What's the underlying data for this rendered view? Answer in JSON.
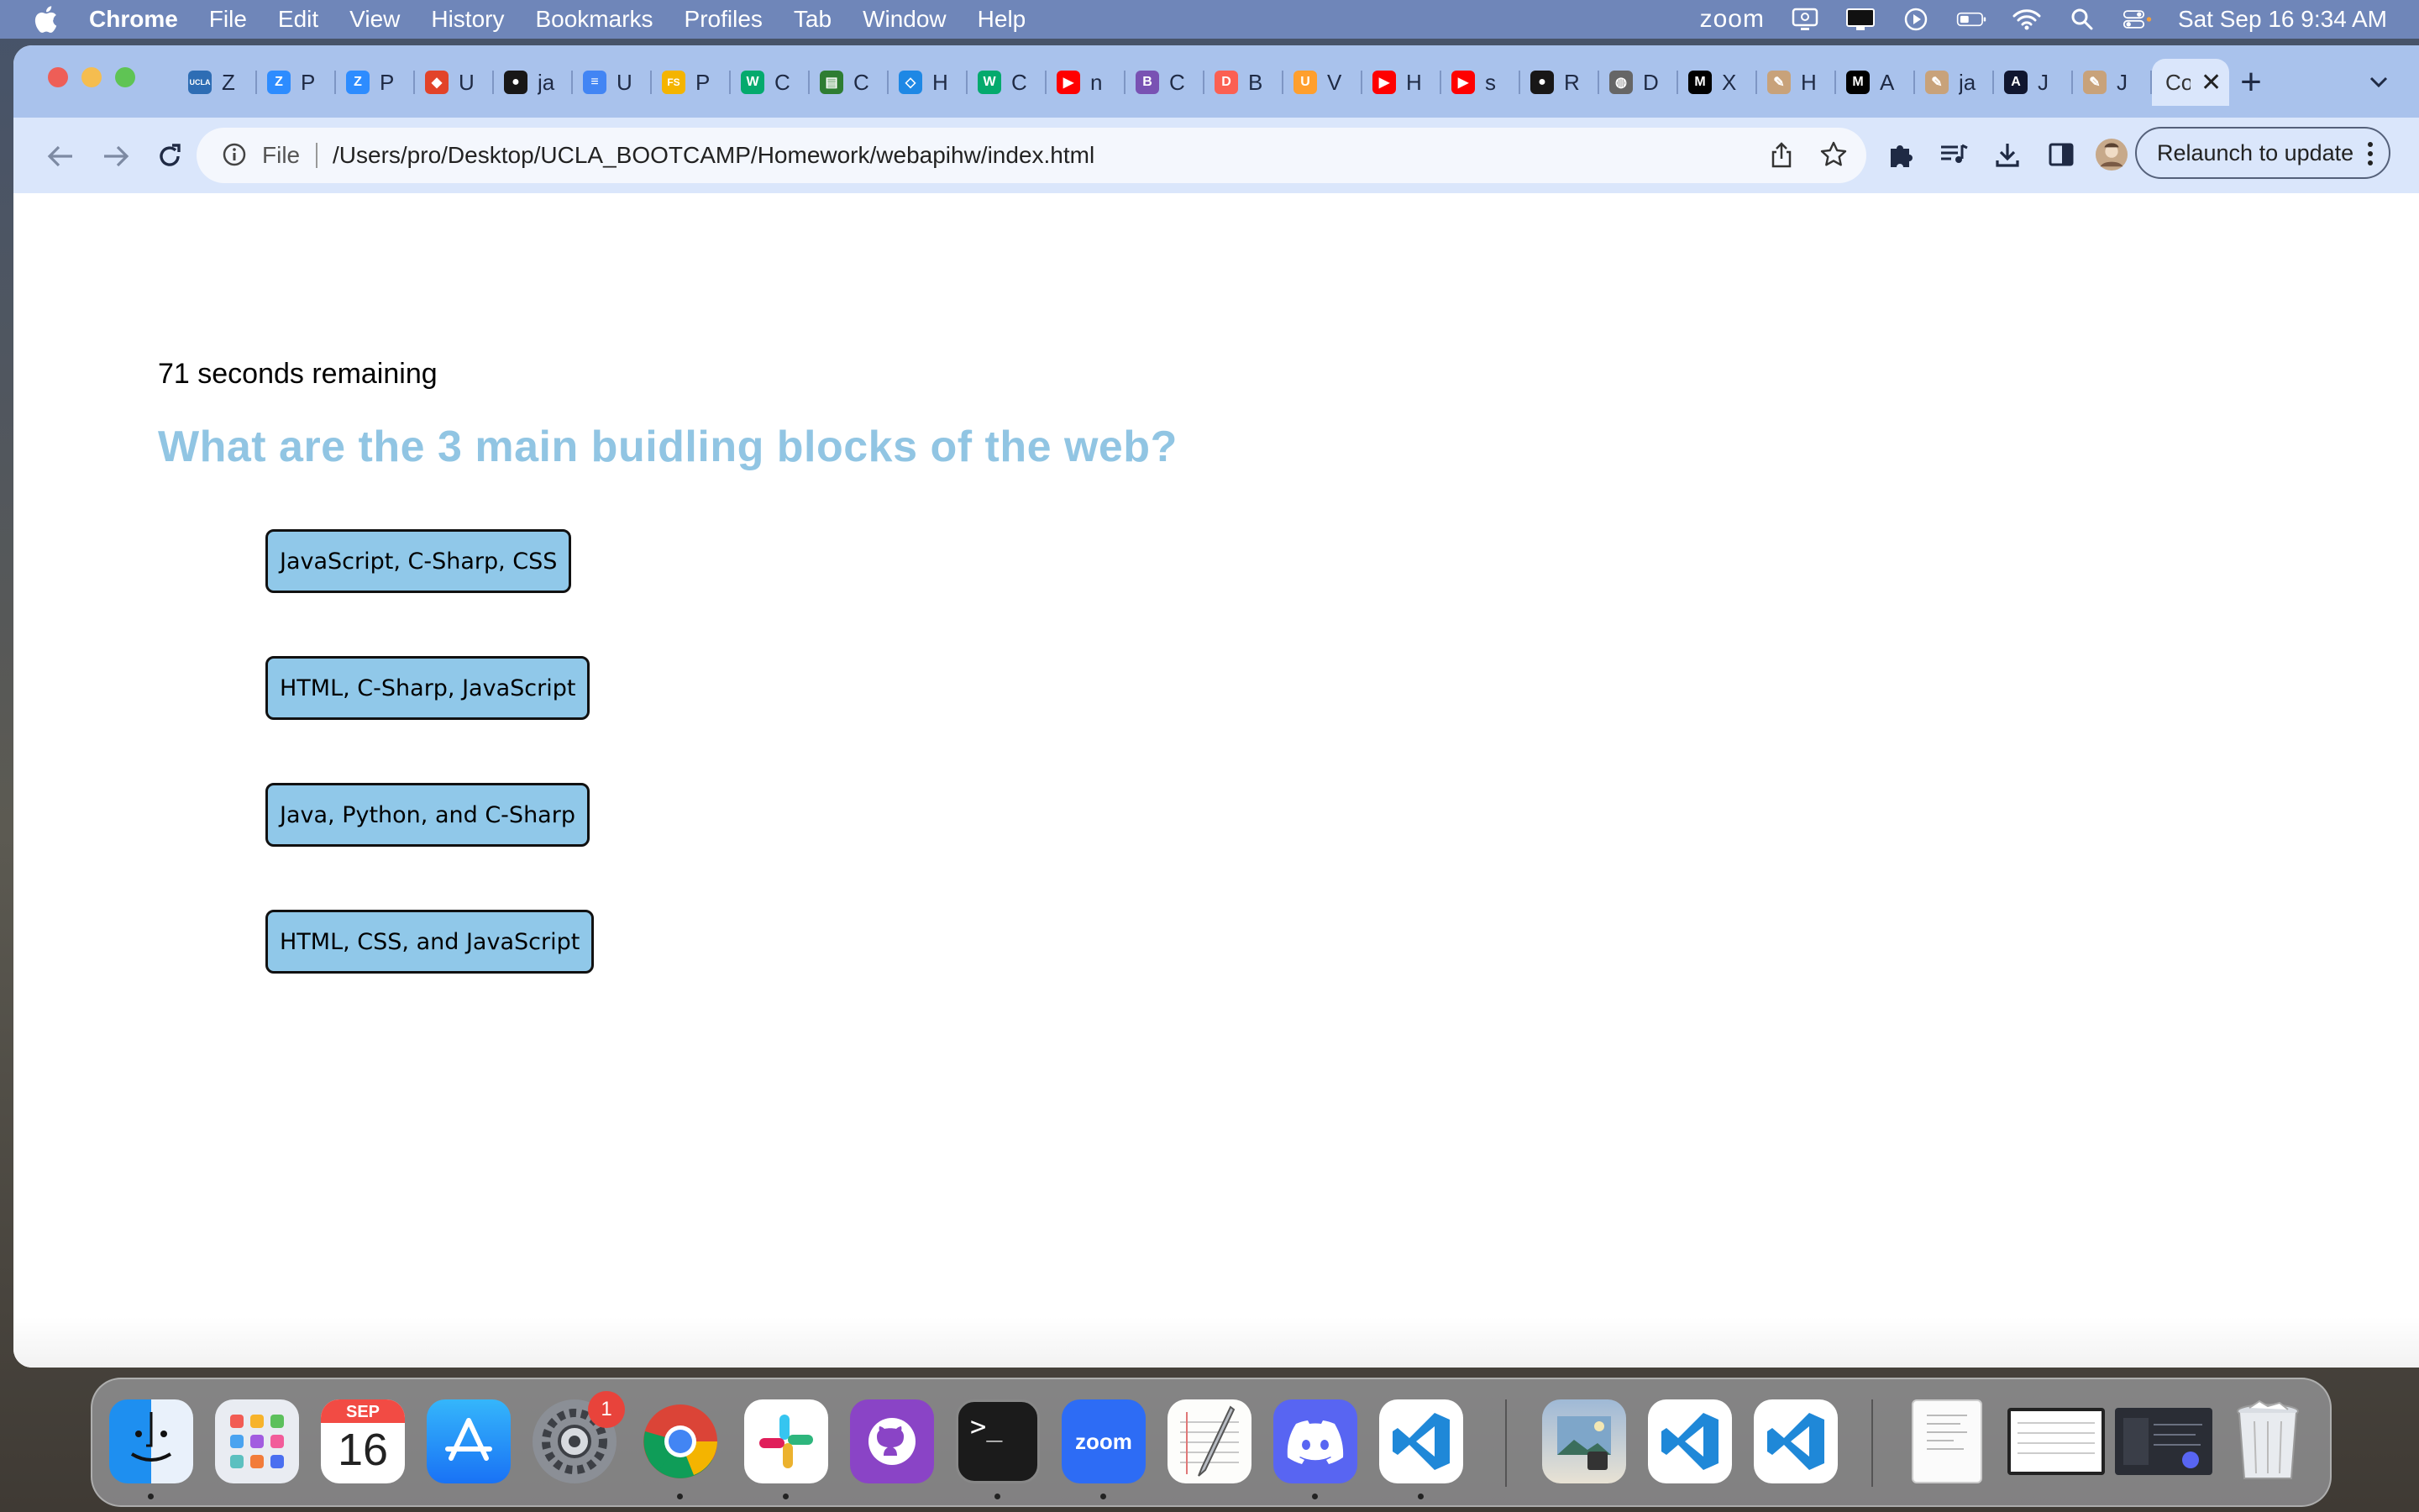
{
  "menubar": {
    "app_name": "Chrome",
    "menus": [
      "File",
      "Edit",
      "View",
      "History",
      "Bookmarks",
      "Profiles",
      "Tab",
      "Window",
      "Help"
    ],
    "zoom_label": "zoom",
    "datetime": "Sat Sep 16  9:34 AM"
  },
  "browser": {
    "tabs": [
      {
        "icon": "ucla-icon",
        "title": "Z",
        "color": "#2e6db4",
        "glyph": "UCLA"
      },
      {
        "icon": "zoom-icon",
        "title": "P",
        "color": "#2d8cff",
        "glyph": "Z"
      },
      {
        "icon": "zoom-icon",
        "title": "P",
        "color": "#2d8cff",
        "glyph": "Z"
      },
      {
        "icon": "gitlab-icon",
        "title": "U",
        "color": "#e24329",
        "glyph": "◆"
      },
      {
        "icon": "github-icon",
        "title": "ja",
        "color": "#181717",
        "glyph": "●"
      },
      {
        "icon": "docs-icon",
        "title": "U",
        "color": "#4285f4",
        "glyph": "≡"
      },
      {
        "icon": "fs-icon",
        "title": "P",
        "color": "#f4b400",
        "glyph": "FS"
      },
      {
        "icon": "w3schools-icon",
        "title": "C",
        "color": "#04aa6d",
        "glyph": "W"
      },
      {
        "icon": "library-icon",
        "title": "C",
        "color": "#2e7d32",
        "glyph": "▤"
      },
      {
        "icon": "code-icon",
        "title": "H",
        "color": "#1e88e5",
        "glyph": "◇"
      },
      {
        "icon": "w3schools-icon",
        "title": "C",
        "color": "#04aa6d",
        "glyph": "W"
      },
      {
        "icon": "youtube-icon",
        "title": "n",
        "color": "#ff0000",
        "glyph": "▶"
      },
      {
        "icon": "bootstrap-icon",
        "title": "C",
        "color": "#7952b3",
        "glyph": "B"
      },
      {
        "icon": "dayjs-icon",
        "title": "B",
        "color": "#fb6052",
        "glyph": "D"
      },
      {
        "icon": "ublock-icon",
        "title": "V",
        "color": "#ff9f2d",
        "glyph": "U"
      },
      {
        "icon": "youtube-icon",
        "title": "H",
        "color": "#ff0000",
        "glyph": "▶"
      },
      {
        "icon": "youtube-icon",
        "title": "s",
        "color": "#ff0000",
        "glyph": "▶"
      },
      {
        "icon": "github-icon",
        "title": "R",
        "color": "#181717",
        "glyph": "●"
      },
      {
        "icon": "globe-icon",
        "title": "D",
        "color": "#666666",
        "glyph": "◍"
      },
      {
        "icon": "mdn-icon",
        "title": "X",
        "color": "#000000",
        "glyph": "M"
      },
      {
        "icon": "postman-icon",
        "title": "H",
        "color": "#c8a27a",
        "glyph": "✎"
      },
      {
        "icon": "mdn-icon",
        "title": "A",
        "color": "#000000",
        "glyph": "M"
      },
      {
        "icon": "postman-icon",
        "title": "ja",
        "color": "#c8a27a",
        "glyph": "✎"
      },
      {
        "icon": "codecademy-icon",
        "title": "J",
        "color": "#10162f",
        "glyph": "A"
      },
      {
        "icon": "postman-icon",
        "title": "J",
        "color": "#c8a27a",
        "glyph": "✎"
      },
      {
        "icon": "file-icon",
        "title": "Co",
        "color": "#dae6fb",
        "glyph": "",
        "active": true
      }
    ],
    "url_scheme_label": "File",
    "url": "/Users/pro/Desktop/UCLA_BOOTCAMP/Homework/webapihw/index.html",
    "relaunch_label": "Relaunch to update"
  },
  "quiz": {
    "timer_text": "71 seconds remaining",
    "question": "What are the 3 main buidling blocks of the web?",
    "choices": [
      "JavaScript, C-Sharp, CSS",
      "HTML, C-Sharp, JavaScript",
      "Java, Python, and C-Sharp",
      "HTML, CSS, and JavaScript"
    ]
  },
  "dock": {
    "calendar_month": "SEP",
    "calendar_day": "16",
    "settings_badge": "1",
    "zoom_label": "zoom",
    "apps": [
      "finder-icon",
      "launchpad-icon",
      "calendar-icon",
      "app-store-icon",
      "system-settings-icon",
      "chrome-icon",
      "slack-icon",
      "github-desktop-icon",
      "terminal-icon",
      "zoom-icon",
      "textedit-icon",
      "discord-icon",
      "vscode-icon",
      "preview-icon",
      "vscode-icon",
      "vscode-icon",
      "document-icon",
      "screenshot-icon",
      "screenshot-icon",
      "trash-icon"
    ]
  },
  "colors": {
    "question": "#91c5e3",
    "choice_bg": "#90c8e9",
    "tabstrip": "#a9c2ec",
    "toolbar": "#dae6fb",
    "menubar": "#6f86b9"
  }
}
